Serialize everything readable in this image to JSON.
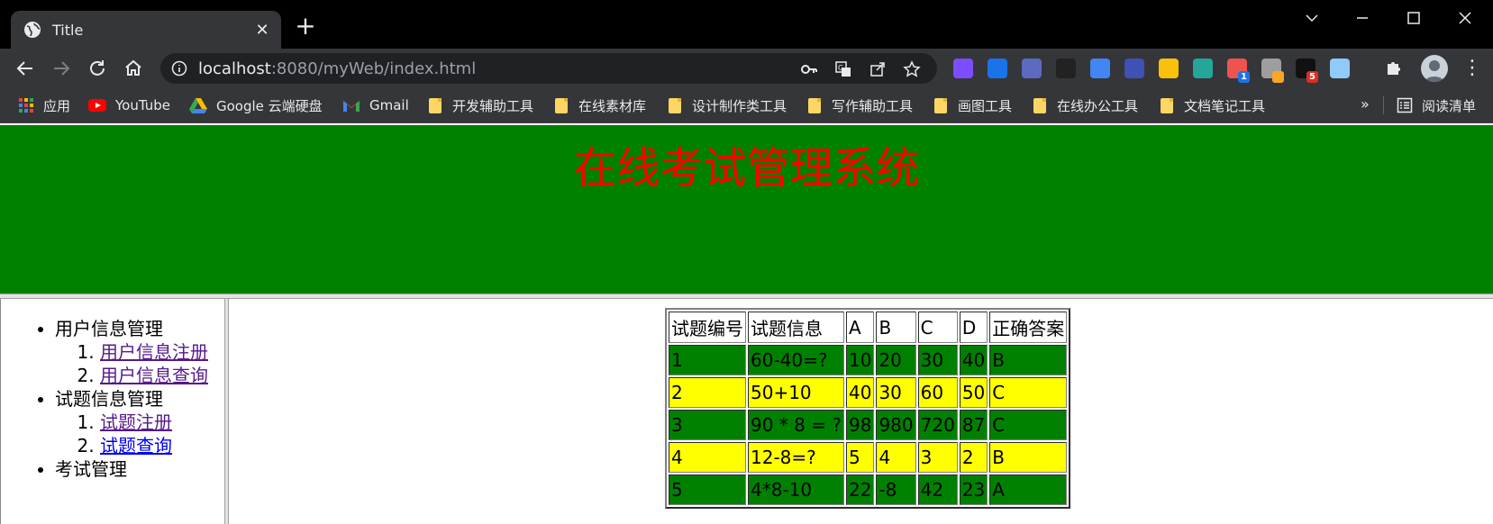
{
  "browser": {
    "tab_title": "Title",
    "url_host": "localhost",
    "url_rest": ":8080/myWeb/index.html",
    "extensions": [
      {
        "name": "color-ring-extension-icon",
        "color": "#7c4dff"
      },
      {
        "name": "gem-extension-icon",
        "color": "#1a73e8"
      },
      {
        "name": "timer-extension-icon",
        "color": "#5c6bc0"
      },
      {
        "name": "letter-l-extension-icon",
        "color": "#222222"
      },
      {
        "name": "translate-extension-icon",
        "color": "#4285f4"
      },
      {
        "name": "graduation-cap-extension-icon",
        "color": "#3f51b5"
      },
      {
        "name": "download-extension-icon",
        "color": "#f9c10b"
      },
      {
        "name": "blocks-extension-icon",
        "color": "#26a69a"
      },
      {
        "name": "cat-extension-icon",
        "color": "#ef5350",
        "badge": "1",
        "badge_color": "#1a73e8"
      },
      {
        "name": "mail-extension-icon",
        "color": "#9e9e9e",
        "badge": "",
        "badge_color": "#f9a825"
      },
      {
        "name": "ghost-extension-icon",
        "color": "#111111",
        "badge": "5",
        "badge_color": "#d93025"
      },
      {
        "name": "screen-extension-icon",
        "color": "#90caf9"
      }
    ]
  },
  "bookmarks": {
    "apps_label": "应用",
    "youtube_label": "YouTube",
    "drive_label": "Google 云端硬盘",
    "gmail_label": "Gmail",
    "folders": [
      "开发辅助工具",
      "在线素材库",
      "设计制作类工具",
      "写作辅助工具",
      "画图工具",
      "在线办公工具",
      "文档笔记工具"
    ],
    "more_label": "»",
    "reading_list_label": "阅读清单"
  },
  "page": {
    "title": "在线考试管理系统",
    "title_color": "#ff0000",
    "banner_color": "#008000"
  },
  "menu": {
    "user_mgmt": "用户信息管理",
    "user_register": "用户信息注册",
    "user_query": "用户信息查询",
    "question_mgmt": "试题信息管理",
    "question_register": "试题注册",
    "question_query": "试题查询",
    "exam_mgmt": "考试管理"
  },
  "table": {
    "headers": [
      "试题编号",
      "试题信息",
      "A",
      "B",
      "C",
      "D",
      "正确答案"
    ],
    "rows": [
      [
        "1",
        "60-40=?",
        "10",
        "20",
        "30",
        "40",
        "B"
      ],
      [
        "2",
        "50+10",
        "40",
        "30",
        "60",
        "50",
        "C"
      ],
      [
        "3",
        "90 * 8 = ?",
        "98",
        "980",
        "720",
        "87",
        "C"
      ],
      [
        "4",
        "12-8=?",
        "5",
        "4",
        "3",
        "2",
        "B"
      ],
      [
        "5",
        "4*8-10",
        "22",
        "-8",
        "42",
        "23",
        "A"
      ]
    ],
    "row_colors": [
      "#008000",
      "#ffff00"
    ]
  }
}
